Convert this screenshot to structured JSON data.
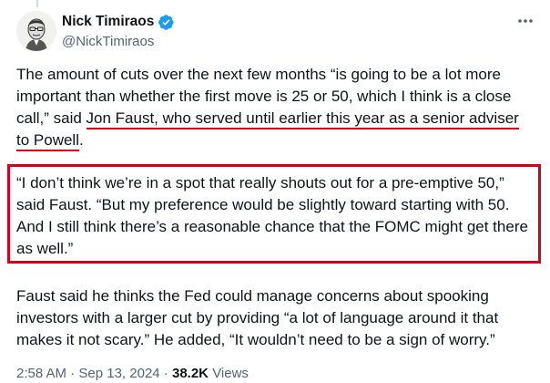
{
  "author": {
    "name": "Nick Timiraos",
    "handle": "@NickTimiraos"
  },
  "icons": {
    "verified": "verified-badge-icon",
    "more": "more-options-icon"
  },
  "tweet": {
    "p1_a": "The amount of cuts over the next few months “is going to be a lot more important than whether the first move is 25 or 50, which I think is a close call,” said ",
    "p1_underlined": "Jon Faust, who served until earlier this year as a senior adviser to Powell",
    "p1_end": ".",
    "p2": "“I don’t think we’re in a spot that really shouts out for a pre-emptive 50,” said Faust. “But my preference would be slightly toward starting with 50. And I still think there’s a reasonable chance that the FOMC might get there as well.”",
    "p3": "Faust said he thinks the Fed could manage concerns about spooking investors with a larger cut by providing “a lot of language around it that makes it not scary.” He added, “It wouldn’t need to be a sign of worry.”"
  },
  "meta": {
    "time": "2:58 AM",
    "date": "Sep 13, 2024",
    "views_count": "38.2K",
    "views_label": "Views"
  },
  "colors": {
    "annotation_red": "#d0021b",
    "verified_blue": "#1d9bf0",
    "secondary_text": "#536471"
  }
}
